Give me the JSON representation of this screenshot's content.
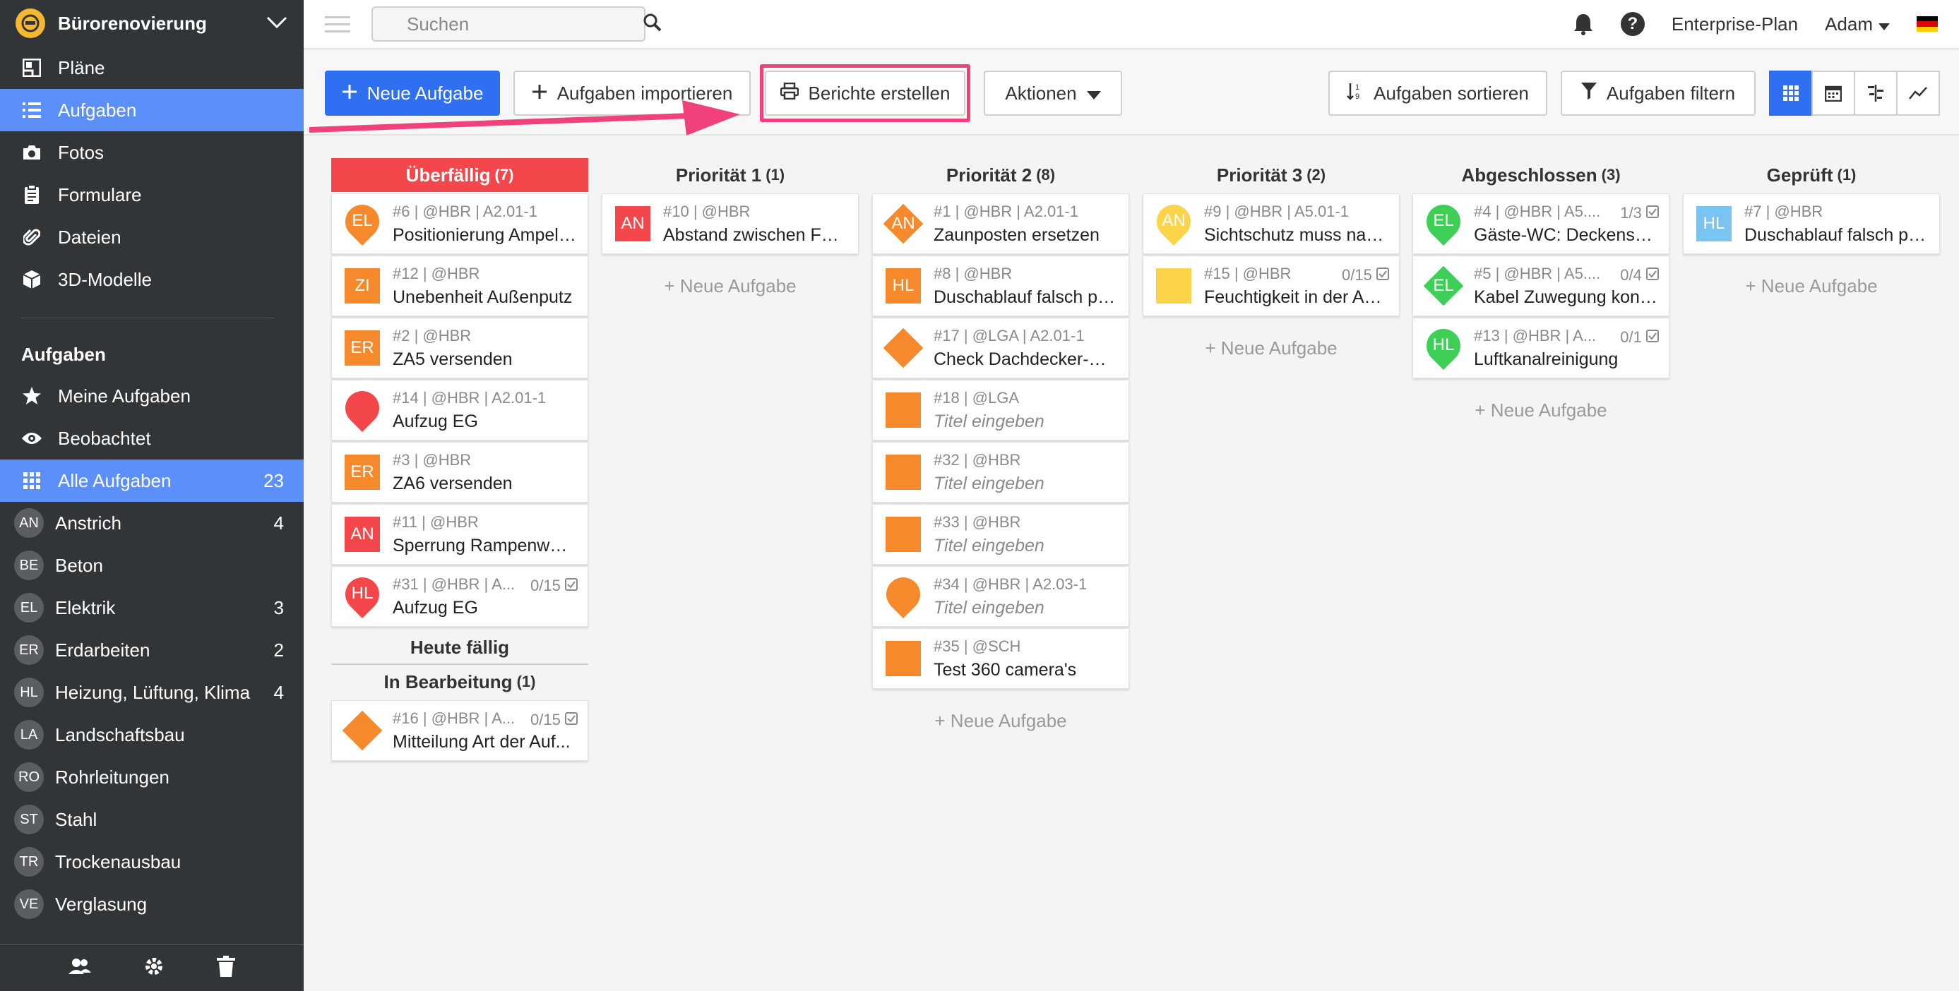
{
  "project": {
    "name": "Bürorenovierung"
  },
  "sidebar": {
    "nav": [
      {
        "label": "Pläne",
        "icon": "plans-icon"
      },
      {
        "label": "Aufgaben",
        "icon": "list-icon",
        "active": true
      },
      {
        "label": "Fotos",
        "icon": "camera-icon"
      },
      {
        "label": "Formulare",
        "icon": "clipboard-icon"
      },
      {
        "label": "Dateien",
        "icon": "paperclip-icon"
      },
      {
        "label": "3D-Modelle",
        "icon": "cube-icon"
      }
    ],
    "tasks_title": "Aufgaben",
    "task_filters": [
      {
        "label": "Meine Aufgaben",
        "icon": "star-icon",
        "count": ""
      },
      {
        "label": "Beobachtet",
        "icon": "eye-icon",
        "count": ""
      },
      {
        "label": "Alle Aufgaben",
        "icon": "grid-icon",
        "count": "23",
        "active": true
      }
    ],
    "trades": [
      {
        "abbr": "AN",
        "label": "Anstrich",
        "count": "4"
      },
      {
        "abbr": "BE",
        "label": "Beton",
        "count": ""
      },
      {
        "abbr": "EL",
        "label": "Elektrik",
        "count": "3"
      },
      {
        "abbr": "ER",
        "label": "Erdarbeiten",
        "count": "2"
      },
      {
        "abbr": "HL",
        "label": "Heizung, Lüftung, Klima",
        "count": "4"
      },
      {
        "abbr": "LA",
        "label": "Landschaftsbau",
        "count": ""
      },
      {
        "abbr": "RO",
        "label": "Rohrleitungen",
        "count": ""
      },
      {
        "abbr": "ST",
        "label": "Stahl",
        "count": ""
      },
      {
        "abbr": "TR",
        "label": "Trockenausbau",
        "count": ""
      },
      {
        "abbr": "VE",
        "label": "Verglasung",
        "count": ""
      }
    ]
  },
  "topbar": {
    "search_placeholder": "Suchen",
    "plan": "Enterprise-Plan",
    "user": "Adam"
  },
  "toolbar": {
    "new_task": "Neue Aufgabe",
    "import": "Aufgaben importieren",
    "reports": "Berichte erstellen",
    "actions": "Aktionen",
    "sort": "Aufgaben sortieren",
    "filter": "Aufgaben filtern"
  },
  "add_task_label": "+ Neue Aufgabe",
  "columns": [
    {
      "title": "Überfällig",
      "count": "(7)",
      "overdue": true,
      "cards": [
        {
          "meta": "#6 | @HBR | A2.01-1",
          "title": "Positionierung Ampela...",
          "marker": "pin",
          "color": "#f5892c",
          "abbr": "EL"
        },
        {
          "meta": "#12 | @HBR",
          "title": "Unebenheit Außenputz",
          "marker": "square",
          "color": "#f5892c",
          "abbr": "ZI"
        },
        {
          "meta": "#2 | @HBR",
          "title": "ZA5 versenden",
          "marker": "square",
          "color": "#f5892c",
          "abbr": "ER"
        },
        {
          "meta": "#14 | @HBR | A2.01-1",
          "title": "Aufzug EG",
          "marker": "pin",
          "color": "#f4474b",
          "abbr": ""
        },
        {
          "meta": "#3 | @HBR",
          "title": "ZA6 versenden",
          "marker": "square",
          "color": "#f5892c",
          "abbr": "ER"
        },
        {
          "meta": "#11 | @HBR",
          "title": "Sperrung Rampenwan...",
          "marker": "square",
          "color": "#f4474b",
          "abbr": "AN"
        },
        {
          "meta": "#31 | @HBR | A...",
          "title": "Aufzug EG",
          "marker": "pin",
          "color": "#f4474b",
          "abbr": "HL",
          "check": "0/15"
        }
      ]
    },
    {
      "title": "Priorität 1",
      "count": "(1)",
      "cards": [
        {
          "meta": "#10 | @HBR",
          "title": "Abstand zwischen Fen...",
          "marker": "square",
          "color": "#f4474b",
          "abbr": "AN"
        }
      ]
    },
    {
      "title": "Priorität 2",
      "count": "(8)",
      "cards": [
        {
          "meta": "#1 | @HBR | A2.01-1",
          "title": "Zaunposten ersetzen",
          "marker": "diamond",
          "color": "#f5892c",
          "abbr": "AN"
        },
        {
          "meta": "#8 | @HBR",
          "title": "Duschablauf falsch pos...",
          "marker": "square",
          "color": "#f5892c",
          "abbr": "HL"
        },
        {
          "meta": "#17 | @LGA | A2.01-1",
          "title": "Check Dachdecker-Ar...",
          "marker": "diamond",
          "color": "#f5892c",
          "abbr": ""
        },
        {
          "meta": "#18 | @LGA",
          "title": "Titel eingeben",
          "placeholder": true,
          "marker": "square",
          "color": "#f5892c",
          "abbr": ""
        },
        {
          "meta": "#32 | @HBR",
          "title": "Titel eingeben",
          "placeholder": true,
          "marker": "square",
          "color": "#f5892c",
          "abbr": ""
        },
        {
          "meta": "#33 | @HBR",
          "title": "Titel eingeben",
          "placeholder": true,
          "marker": "square",
          "color": "#f5892c",
          "abbr": ""
        },
        {
          "meta": "#34 | @HBR | A2.03-1",
          "title": "Titel eingeben",
          "placeholder": true,
          "marker": "pin",
          "color": "#f5892c",
          "abbr": ""
        },
        {
          "meta": "#35 | @SCH",
          "title": "Test 360 camera's",
          "marker": "square",
          "color": "#f5892c",
          "abbr": ""
        }
      ]
    },
    {
      "title": "Priorität 3",
      "count": "(2)",
      "cards": [
        {
          "meta": "#9 | @HBR | A5.01-1",
          "title": "Sichtschutz muss nachl...",
          "marker": "pin",
          "color": "#fbd44a",
          "abbr": "AN"
        },
        {
          "meta": "#15 | @HBR",
          "title": "Feuchtigkeit in der Auf...",
          "marker": "square",
          "color": "#fbd44a",
          "abbr": "",
          "check": "0/15"
        }
      ]
    },
    {
      "title": "Abgeschlossen",
      "count": "(3)",
      "cards": [
        {
          "meta": "#4 | @HBR | A5....",
          "title": "Gäste-WC: Deckenspo...",
          "marker": "pin",
          "color": "#3ecf56",
          "abbr": "EL",
          "check": "1/3"
        },
        {
          "meta": "#5 | @HBR | A5....",
          "title": "Kabel Zuwegung kontr...",
          "marker": "diamond",
          "color": "#3ecf56",
          "abbr": "EL",
          "check": "0/4"
        },
        {
          "meta": "#13 | @HBR | A...",
          "title": "Luftkanalreinigung",
          "marker": "pin",
          "color": "#3ecf56",
          "abbr": "HL",
          "check": "0/1"
        }
      ]
    },
    {
      "title": "Geprüft",
      "count": "(1)",
      "cards": [
        {
          "meta": "#7 | @HBR",
          "title": "Duschablauf falsch pos...",
          "marker": "square",
          "color": "#7ac4f2",
          "abbr": "HL"
        }
      ]
    }
  ],
  "subsections": {
    "today": {
      "title": "Heute fällig"
    },
    "in_progress": {
      "title": "In Bearbeitung",
      "count": "(1)",
      "cards": [
        {
          "meta": "#16 | @HBR | A...",
          "title": "Mitteilung Art der Auf...",
          "marker": "diamond",
          "color": "#f5892c",
          "abbr": "",
          "check": "0/15"
        }
      ]
    }
  }
}
